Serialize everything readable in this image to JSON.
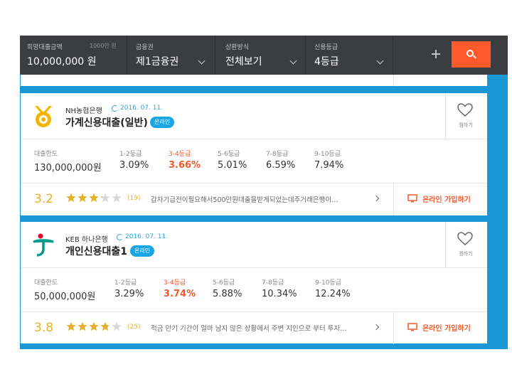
{
  "filters": {
    "amount": {
      "label": "희망대출금액",
      "unit": "1000만 원",
      "value": "10,000,000 원"
    },
    "institution": {
      "label": "금융권",
      "value": "제1금융권"
    },
    "repayment": {
      "label": "상환방식",
      "value": "전체보기"
    },
    "credit": {
      "label": "신용등급",
      "value": "4등급"
    }
  },
  "grade_labels": [
    "1-2등급",
    "3-4등급",
    "5-6등급",
    "7-8등급",
    "9-10등급"
  ],
  "limit_label": "대출한도",
  "favorite_label": "찜하기",
  "join_label": "온라인 가입하기",
  "colors": {
    "accent": "#ff5a2b",
    "brand_blue": "#1a97d5",
    "star": "#e8b028",
    "badge": "#1aa6e4",
    "bar": "#3b3d40"
  },
  "cards": [
    {
      "bank": "NH농협은행",
      "date": "2016. 07. 11.",
      "product": "가계신용대출(일반)",
      "badge": "온라인",
      "logo": "nh-bank-logo-icon",
      "limit": "130,000,000원",
      "rates": [
        "3.09%",
        "3.66%",
        "5.01%",
        "6.59%",
        "7.94%"
      ],
      "highlight_index": 1,
      "score": "3.2",
      "rating": 3.2,
      "count": "(19)",
      "review": "갑자기급전이필요해서500만원대출을받게되었는데주거래은행이…"
    },
    {
      "bank": "KEB 하나은행",
      "date": "2016. 07. 11.",
      "product": "개인신용대출1",
      "badge": "온라인",
      "logo": "keb-hana-logo-icon",
      "limit": "50,000,000원",
      "rates": [
        "3.29%",
        "3.74%",
        "5.88%",
        "10.34%",
        "12.24%"
      ],
      "highlight_index": 1,
      "score": "3.8",
      "rating": 3.8,
      "count": "(25)",
      "review": "적금 만기 기간이 얼마 남지 않은 상황에서 주변 지인으로 부터 투자…"
    }
  ]
}
